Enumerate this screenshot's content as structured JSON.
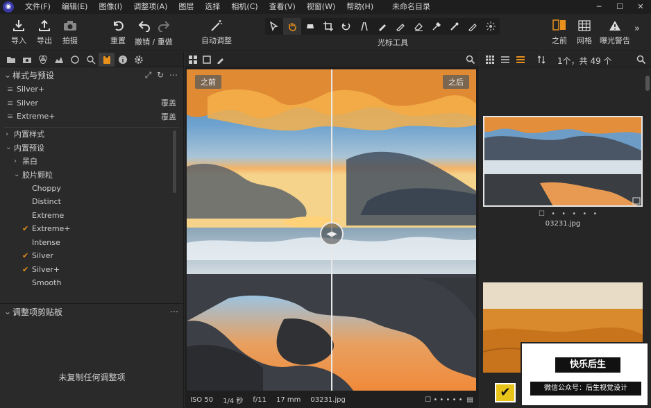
{
  "menu": {
    "items": [
      "文件(F)",
      "编辑(E)",
      "图像(I)",
      "调整项(A)",
      "图层",
      "选择",
      "相机(C)",
      "查看(V)",
      "视窗(W)",
      "帮助(H)"
    ]
  },
  "window": {
    "title": "未命名目录",
    "minimize": "─",
    "maximize": "☐",
    "close": "✕"
  },
  "toolbar": {
    "import": "导入",
    "export": "导出",
    "capture": "拍摄",
    "reset": "重置",
    "undo_redo": "撤销 / 重做",
    "auto_adjust": "自动调整",
    "cursor_tools": "光标工具",
    "before": "之前",
    "grid": "网格",
    "exposure_warning": "曝光警告"
  },
  "styles_presets": {
    "title": "样式与预设",
    "items": [
      {
        "label": "Silver+",
        "note": ""
      },
      {
        "label": "Silver",
        "note": "覆盖"
      },
      {
        "label": "Extreme+",
        "note": "覆盖"
      }
    ]
  },
  "builtin_styles": {
    "label": "内置样式"
  },
  "builtin_presets": {
    "label": "内置预设",
    "bw": "黑白",
    "film_grain": "胶片颗粒",
    "grain_items": [
      {
        "label": "Choppy",
        "checked": false
      },
      {
        "label": "Distinct",
        "checked": false
      },
      {
        "label": "Extreme",
        "checked": false
      },
      {
        "label": "Extreme+",
        "checked": true
      },
      {
        "label": "Intense",
        "checked": false
      },
      {
        "label": "Silver",
        "checked": true
      },
      {
        "label": "Silver+",
        "checked": true
      },
      {
        "label": "Smooth",
        "checked": false
      }
    ]
  },
  "clipboard": {
    "title": "调整项剪贴板",
    "message": "未复制任何调整项"
  },
  "viewer": {
    "before_tag": "之前",
    "after_tag": "之后",
    "iso": "ISO 50",
    "shutter": "1/4 秒",
    "aperture": "f/11",
    "focal": "17 mm",
    "filename": "03231.jpg"
  },
  "browser": {
    "count": "1个，共 49 个",
    "thumb1_name": "03231.jpg"
  },
  "watermark": {
    "title": "快乐后生",
    "subtitle": "微信公众号：后生视觉设计"
  },
  "colors": {
    "accent": "#e8901b",
    "bg": "#2b2b2b"
  }
}
